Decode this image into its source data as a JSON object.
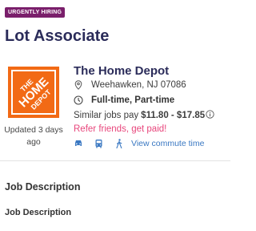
{
  "badge": "URGENTLY HIRING",
  "job_title": "Lot Associate",
  "company": {
    "name": "The Home Depot",
    "logo_text": [
      "THE",
      "HOME",
      "DEPOT"
    ],
    "brand_color": "#f26a15",
    "location": "Weehawken, NJ 07086",
    "job_type": "Full-time, Part-time",
    "pay_prefix": "Similar jobs pay",
    "pay_range": "$11.80 - $17.85",
    "refer": "Refer friends, get paid!",
    "commute_link": "View commute time",
    "commute_icons": [
      "car-icon",
      "bus-icon",
      "walk-icon"
    ]
  },
  "updated": "Updated 3 days ago",
  "section": {
    "heading": "Job Description",
    "subheading": "Job Description"
  },
  "colors": {
    "badge_bg": "#7a1f6b",
    "title": "#2b2c5a",
    "refer": "#e8467c",
    "link": "#3a78c2"
  }
}
